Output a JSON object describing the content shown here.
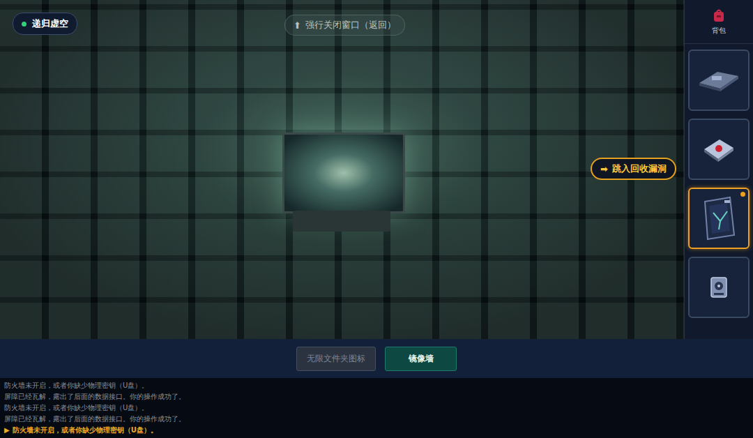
{
  "location": {
    "label": "递归虚空"
  },
  "hotspots": [
    {
      "icon": "⬆",
      "label": "强行关闭窗口（返回）",
      "highlighted": false
    },
    {
      "icon": "➡",
      "label": "跳入回收漏洞",
      "highlighted": true
    }
  ],
  "inventory": {
    "title": "背包",
    "items": [
      {
        "selected": false,
        "new": false
      },
      {
        "selected": false,
        "new": false
      },
      {
        "selected": true,
        "new": true
      },
      {
        "selected": false,
        "new": false
      }
    ]
  },
  "actions": [
    {
      "label": "无限文件夹图标",
      "disabled": true
    },
    {
      "label": "镜像墙",
      "disabled": false
    }
  ],
  "log": [
    {
      "marker": "",
      "text": "防火墙未开启，或者你缺少物理密钥（U盘）。",
      "latest": false
    },
    {
      "marker": "",
      "text": "屏障已经瓦解，露出了后面的数据接口。你的操作成功了。",
      "latest": false
    },
    {
      "marker": "",
      "text": "防火墙未开启，或者你缺少物理密钥（U盘）。",
      "latest": false
    },
    {
      "marker": "",
      "text": "屏障已经瓦解，露出了后面的数据接口。你的操作成功了。",
      "latest": false
    },
    {
      "marker": "▶",
      "text": "防火墙未开启，或者你缺少物理密钥（U盘）。",
      "latest": true
    }
  ]
}
